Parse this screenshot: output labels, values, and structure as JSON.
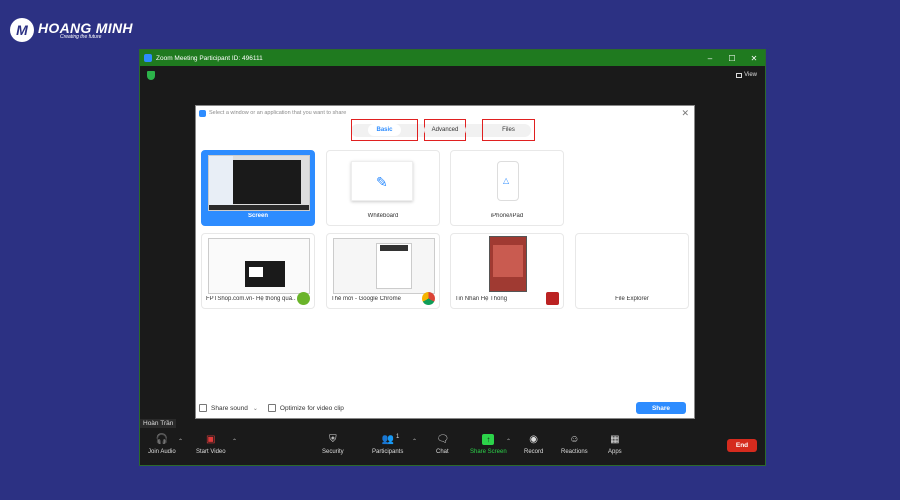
{
  "logo": {
    "name": "HOANG MINH",
    "tagline": "Creating the future"
  },
  "window": {
    "title": "Zoom Meeting Participant ID: 496111",
    "view_label": "View"
  },
  "participant_name": "Hoàn Trần",
  "dialog": {
    "header": "Select a window or an application that you want to share",
    "tabs": [
      {
        "label": "Basic",
        "active": true
      },
      {
        "label": "Advanced"
      },
      {
        "label": "Files"
      }
    ],
    "tiles": [
      {
        "label": "Screen",
        "selected": true
      },
      {
        "label": "Whiteboard"
      },
      {
        "label": "iPhone/iPad"
      },
      {
        "label": "FPTShop.com.vn- Hệ thống quả..."
      },
      {
        "label": "Thẻ mới - Google Chrome"
      },
      {
        "label": "Tin Nhắn Hệ Thống"
      },
      {
        "label": "File Explorer"
      }
    ],
    "share_sound_label": "Share sound",
    "optimize_label": "Optimize for video clip",
    "share_button": "Share"
  },
  "toolbar": {
    "join_audio": "Join Audio",
    "start_video": "Start Video",
    "security": "Security",
    "participants": "Participants",
    "participants_count": "1",
    "chat": "Chat",
    "share_screen": "Share Screen",
    "record": "Record",
    "reactions": "Reactions",
    "apps": "Apps",
    "end": "End"
  },
  "colors": {
    "background": "#2c3183",
    "zoom_blue": "#2d8cff",
    "titlebar_green": "#1f7a1f",
    "end_red": "#d52b1e",
    "highlight_red": "#e02020"
  }
}
